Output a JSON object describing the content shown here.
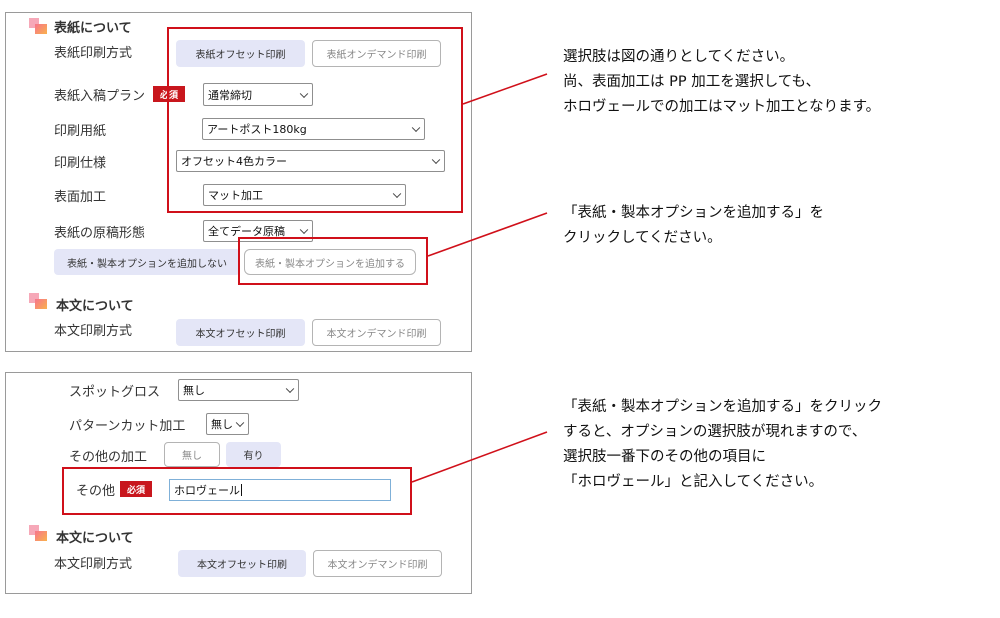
{
  "panel1": {
    "cover_section_title": "表紙について",
    "cover_print_method_label": "表紙印刷方式",
    "cover_offset_button": "表紙オフセット印刷",
    "cover_ondemand_button": "表紙オンデマンド印刷",
    "cover_plan_label": "表紙入稿プラン",
    "required_badge": "必須",
    "cover_plan_value": "通常締切",
    "paper_label": "印刷用紙",
    "paper_value": "アートポスト180kg",
    "spec_label": "印刷仕様",
    "spec_value": "オフセット4色カラー",
    "finish_label": "表面加工",
    "finish_value": "マット加工",
    "manuscript_label": "表紙の原稿形態",
    "manuscript_value": "全てデータ原稿",
    "no_option_button": "表紙・製本オプションを追加しない",
    "add_option_button": "表紙・製本オプションを追加する",
    "body_section_title": "本文について",
    "body_print_method_label": "本文印刷方式",
    "body_offset_button": "本文オフセット印刷",
    "body_ondemand_button": "本文オンデマンド印刷"
  },
  "panel2": {
    "spot_gloss_label": "スポットグロス",
    "spot_gloss_value": "無し",
    "pattern_cut_label": "パターンカット加工",
    "pattern_cut_value": "無し",
    "other_process_label": "その他の加工",
    "none_button": "無し",
    "yes_button": "有り",
    "other_label": "その他",
    "required_badge": "必須",
    "other_input_value": "ホロヴェール",
    "body_section_title": "本文について",
    "body_print_method_label": "本文印刷方式",
    "body_offset_button": "本文オフセット印刷",
    "body_ondemand_button": "本文オンデマンド印刷"
  },
  "notes": {
    "note1_line1": "選択肢は図の通りとしてください。",
    "note1_line2": "尚、表面加工は PP 加工を選択しても、",
    "note1_line3": "ホロヴェールでの加工はマット加工となります。",
    "note2_line1": "「表紙・製本オプションを追加する」を",
    "note2_line2": "クリックしてください。",
    "note3_line1": "「表紙・製本オプションを追加する」をクリック",
    "note3_line2": "すると、オプションの選択肢が現れますので、",
    "note3_line3": "選択肢一番下のその他の項目に",
    "note3_line4": "「ホロヴェール」と記入してください。"
  },
  "colors": {
    "highlight_red": "#d0101a",
    "selected_button": "#e4e6f7",
    "required_badge": "#c8161d"
  },
  "icons": [
    "section-marker-icon",
    "chevron-down-icon"
  ]
}
